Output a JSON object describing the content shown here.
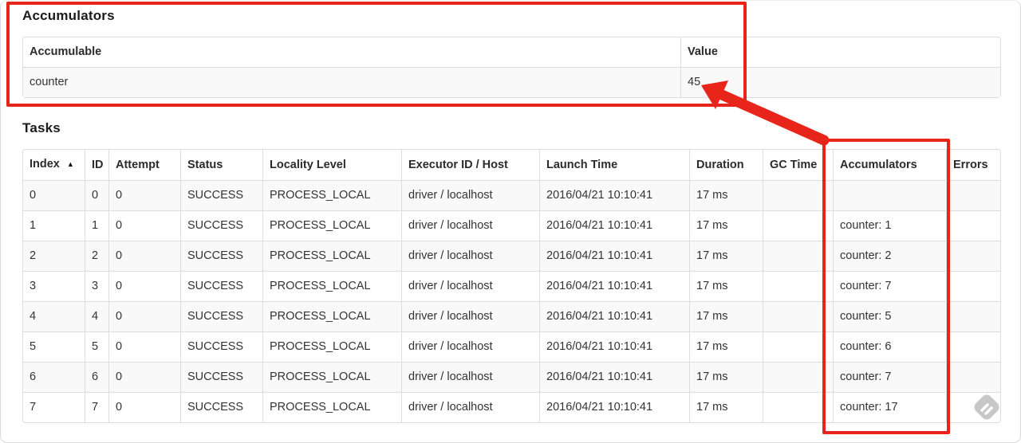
{
  "accumulators_section": {
    "title": "Accumulators",
    "table": {
      "headers": [
        {
          "label": "Accumulable"
        },
        {
          "label": "Value"
        }
      ],
      "rows": [
        [
          "counter",
          "45"
        ]
      ]
    }
  },
  "tasks_section": {
    "title": "Tasks",
    "table": {
      "headers": [
        {
          "label": "Index",
          "sort_icon": "▲"
        },
        {
          "label": "ID"
        },
        {
          "label": "Attempt"
        },
        {
          "label": "Status"
        },
        {
          "label": "Locality Level"
        },
        {
          "label": "Executor ID / Host"
        },
        {
          "label": "Launch Time"
        },
        {
          "label": "Duration"
        },
        {
          "label": "GC Time"
        },
        {
          "label": "Accumulators"
        },
        {
          "label": "Errors"
        }
      ],
      "rows": [
        [
          "0",
          "0",
          "0",
          "SUCCESS",
          "PROCESS_LOCAL",
          "driver / localhost",
          "2016/04/21 10:10:41",
          "17 ms",
          "",
          "",
          ""
        ],
        [
          "1",
          "1",
          "0",
          "SUCCESS",
          "PROCESS_LOCAL",
          "driver / localhost",
          "2016/04/21 10:10:41",
          "17 ms",
          "",
          "counter: 1",
          ""
        ],
        [
          "2",
          "2",
          "0",
          "SUCCESS",
          "PROCESS_LOCAL",
          "driver / localhost",
          "2016/04/21 10:10:41",
          "17 ms",
          "",
          "counter: 2",
          ""
        ],
        [
          "3",
          "3",
          "0",
          "SUCCESS",
          "PROCESS_LOCAL",
          "driver / localhost",
          "2016/04/21 10:10:41",
          "17 ms",
          "",
          "counter: 7",
          ""
        ],
        [
          "4",
          "4",
          "0",
          "SUCCESS",
          "PROCESS_LOCAL",
          "driver / localhost",
          "2016/04/21 10:10:41",
          "17 ms",
          "",
          "counter: 5",
          ""
        ],
        [
          "5",
          "5",
          "0",
          "SUCCESS",
          "PROCESS_LOCAL",
          "driver / localhost",
          "2016/04/21 10:10:41",
          "17 ms",
          "",
          "counter: 6",
          ""
        ],
        [
          "6",
          "6",
          "0",
          "SUCCESS",
          "PROCESS_LOCAL",
          "driver / localhost",
          "2016/04/21 10:10:41",
          "17 ms",
          "",
          "counter: 7",
          ""
        ],
        [
          "7",
          "7",
          "0",
          "SUCCESS",
          "PROCESS_LOCAL",
          "driver / localhost",
          "2016/04/21 10:10:41",
          "17 ms",
          "",
          "counter: 17",
          ""
        ]
      ]
    }
  },
  "annotations": {
    "highlight_color": "#e8251b",
    "boxes": [
      "accumulators-section",
      "tasks-accumulators-column"
    ],
    "arrow_points_to": "45"
  },
  "icons": {
    "sort_ascending": "▲",
    "watermark": "diamond-ribbon-icon"
  }
}
